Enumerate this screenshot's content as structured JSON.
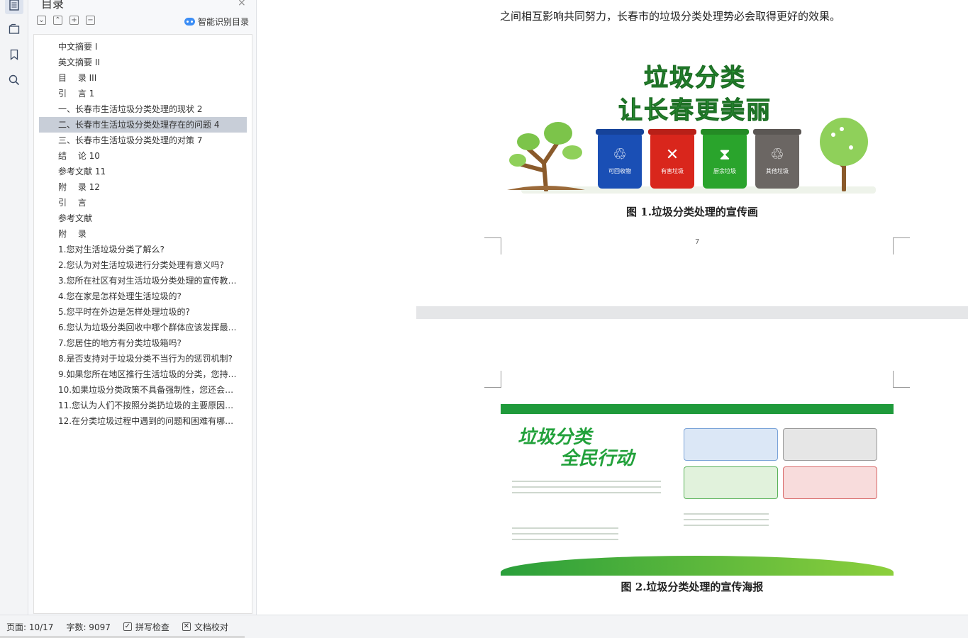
{
  "panel": {
    "title": "目录",
    "close": "×",
    "tools": [
      "⌄",
      "⌃",
      "+",
      "−"
    ],
    "smart_label": "智能识别目录"
  },
  "outline": [
    "中文摘要 I",
    "英文摘要 II",
    "目　 录 III",
    "引　 言 1",
    "一、长春市生活垃圾分类处理的现状 2",
    "二、长春市生活垃圾分类处理存在的问题 4",
    "三、长春市生活垃圾分类处理的对策 7",
    "结　 论 10",
    "参考文献 11",
    "附　 录 12",
    "引　 言",
    "参考文献",
    "附　 录",
    "1.您对生活垃圾分类了解么?",
    "2.您认为对生活垃圾进行分类处理有意义吗?",
    "3.您所在社区有对生活垃圾分类处理的宣传教育...",
    "4.您在家是怎样处理生活垃圾的?",
    "5.您平时在外边是怎样处理垃圾的?",
    "6.您认为垃圾分类回收中哪个群体应该发挥最大...",
    "7.您居住的地方有分类垃圾箱吗?",
    "8.是否支持对于垃圾分类不当行为的惩罚机制?",
    "9.如果您所在地区推行生活垃圾的分类，您持有...",
    "10.如果垃圾分类政策不具备强制性，您还会选...",
    "11.您认为人们不按照分类扔垃圾的主要原因有...",
    "12.在分类垃圾过程中遇到的问题和困难有哪些..."
  ],
  "selected_index": 5,
  "document": {
    "page1_text": "之间相互影响共同努力，长春市的垃圾分类处理势必会取得更好的效果。",
    "fig1_line1": "垃圾分类",
    "fig1_line2": "让长春更美丽",
    "bins": [
      {
        "label": "可回收物",
        "symbol": "♲",
        "color": "#1a4fb5"
      },
      {
        "label": "有害垃圾",
        "symbol": "✕",
        "color": "#d9261c"
      },
      {
        "label": "厨余垃圾",
        "symbol": "⧗",
        "color": "#2aa42c"
      },
      {
        "label": "其他垃圾",
        "symbol": "♲",
        "color": "#6b6663"
      }
    ],
    "caption1": "图 1.垃圾分类处理的宣传画",
    "page_number": "7",
    "poster_line1": "垃圾分类",
    "poster_line2": "全民行动",
    "caption2": "图 2.垃圾分类处理的宣传海报"
  },
  "status": {
    "page": "页面: 10/17",
    "words": "字数: 9097",
    "spell": "拼写检查",
    "proof": "文档校对"
  }
}
